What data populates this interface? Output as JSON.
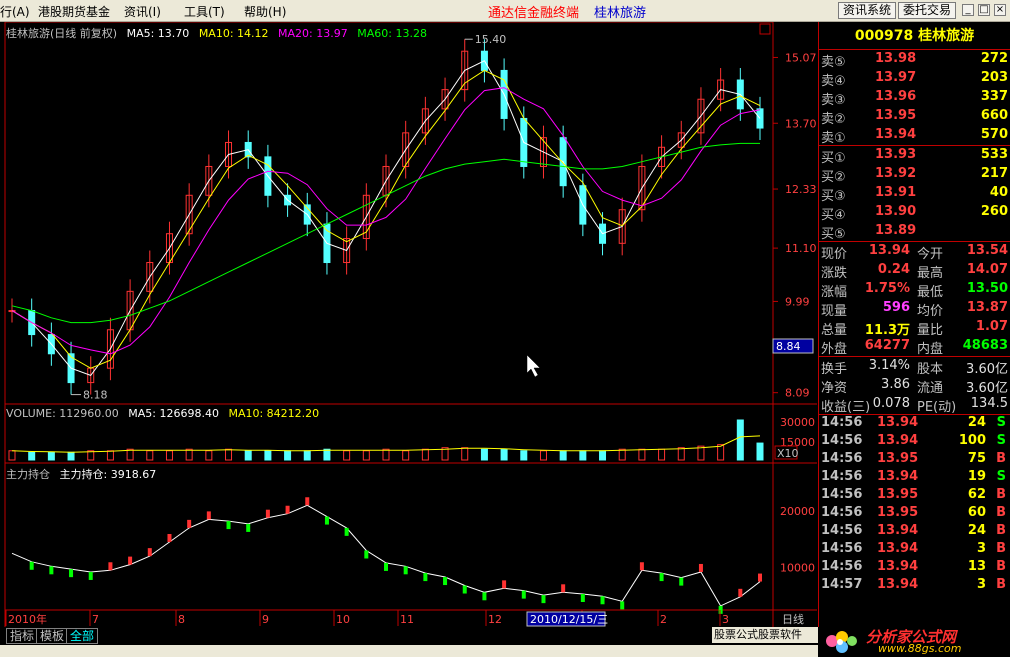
{
  "menubar": {
    "items": [
      "行(A)",
      "港股期货基金",
      "资讯(I)",
      "工具(T)",
      "帮助(H)"
    ],
    "app_title": "通达信金融终端",
    "stock_title": "桂林旅游",
    "buttons": [
      "资讯系统",
      "委托交易"
    ]
  },
  "chart_header": {
    "name": "桂林旅游(日线 前复权)",
    "ma5": "MA5: 13.70",
    "ma10": "MA10: 14.12",
    "ma20": "MA20: 13.97",
    "ma60": "MA60: 13.28"
  },
  "price_axis": {
    "labels": [
      "15.07",
      "13.70",
      "12.33",
      "11.10",
      "9.99",
      "8.09"
    ],
    "current_price_box": "8.84",
    "high_label": "15.40",
    "low_label": "8.18"
  },
  "volume_header": {
    "volume": "VOLUME: 112960.00",
    "ma5": "MA5: 126698.40",
    "ma10": "MA10: 84212.20"
  },
  "volume_axis": {
    "labels": [
      "30000",
      "15000"
    ],
    "unit": "X10"
  },
  "indicator_header": {
    "name": "主力持仓",
    "value": "主力持仓: 3918.67"
  },
  "indicator_axis": {
    "labels": [
      "20000",
      "10000"
    ]
  },
  "time_axis": {
    "labels": [
      "2010年",
      "7",
      "8",
      "9",
      "10",
      "11",
      "12",
      "1",
      "2",
      "3"
    ],
    "cursor_date": "2010/12/15/三",
    "right_label": "日线"
  },
  "colors": {
    "up": "#ff3232",
    "down": "#54ffff",
    "ma5": "#ffffff",
    "ma10": "#ffff00",
    "ma20": "#ff00ff",
    "ma60": "#00ff00",
    "border": "#c00000"
  },
  "chart_data": {
    "type": "line",
    "price_series": {
      "name": "桂林旅游",
      "values": [
        9.8,
        9.3,
        8.9,
        8.3,
        8.6,
        9.4,
        10.2,
        10.8,
        11.4,
        12.2,
        12.8,
        13.3,
        13.0,
        12.2,
        12.0,
        11.6,
        10.8,
        11.3,
        12.2,
        12.8,
        13.5,
        14.0,
        14.4,
        15.2,
        14.8,
        13.8,
        12.8,
        13.4,
        12.4,
        11.6,
        11.2,
        11.9,
        12.8,
        13.2,
        13.5,
        14.2,
        14.6,
        14.0,
        13.6
      ]
    },
    "ma60_series": {
      "name": "MA60",
      "values": [
        9.9,
        9.8,
        9.65,
        9.55,
        9.55,
        9.6,
        9.7,
        9.85,
        10.0,
        10.2,
        10.4,
        10.6,
        10.8,
        11.0,
        11.2,
        11.4,
        11.6,
        11.8,
        12.0,
        12.2,
        12.4,
        12.6,
        12.75,
        12.85,
        12.9,
        12.95,
        12.9,
        12.85,
        12.8,
        12.75,
        12.75,
        12.8,
        12.9,
        13.0,
        13.1,
        13.2,
        13.25,
        13.28,
        13.28
      ]
    },
    "ylim": [
      8.0,
      15.6
    ],
    "volume_values": [
      6,
      5,
      5,
      5,
      6,
      6,
      7,
      6,
      6,
      7,
      6,
      7,
      6,
      6,
      6,
      6,
      7,
      6,
      6,
      7,
      6,
      7,
      8,
      8,
      7,
      7,
      6,
      6,
      6,
      6,
      6,
      7,
      7,
      7,
      8,
      9,
      10,
      26,
      11
    ],
    "indicator_values": [
      12500,
      11000,
      10200,
      9700,
      9200,
      9500,
      10500,
      12000,
      14500,
      17000,
      18500,
      18200,
      17700,
      18800,
      19500,
      21000,
      19000,
      17000,
      13000,
      10800,
      10200,
      9000,
      8300,
      6800,
      5600,
      6300,
      5900,
      5100,
      5600,
      5300,
      4900,
      4000,
      9500,
      9000,
      8200,
      9200,
      3200,
      4800,
      7500
    ],
    "indicator_ylim": [
      3000,
      26000
    ]
  },
  "quote": {
    "code": "000978",
    "name": "桂林旅游",
    "asks": [
      {
        "label": "卖⑤",
        "price": "13.98",
        "vol": "272"
      },
      {
        "label": "卖④",
        "price": "13.97",
        "vol": "203"
      },
      {
        "label": "卖③",
        "price": "13.96",
        "vol": "337"
      },
      {
        "label": "卖②",
        "price": "13.95",
        "vol": "660"
      },
      {
        "label": "卖①",
        "price": "13.94",
        "vol": "570"
      }
    ],
    "bids": [
      {
        "label": "买①",
        "price": "13.93",
        "vol": "533"
      },
      {
        "label": "买②",
        "price": "13.92",
        "vol": "217"
      },
      {
        "label": "买③",
        "price": "13.91",
        "vol": "40"
      },
      {
        "label": "买④",
        "price": "13.90",
        "vol": "260"
      },
      {
        "label": "买⑤",
        "price": "13.89",
        "vol": ""
      }
    ],
    "stats": [
      {
        "l1": "现价",
        "v1": "13.94",
        "l2": "今开",
        "v2": "13.54",
        "c1": "#ff4040",
        "c2": "#ff4040"
      },
      {
        "l1": "涨跌",
        "v1": "0.24",
        "l2": "最高",
        "v2": "14.07",
        "c1": "#ff4040",
        "c2": "#ff4040"
      },
      {
        "l1": "涨幅",
        "v1": "1.75%",
        "l2": "最低",
        "v2": "13.50",
        "c1": "#ff4040",
        "c2": "#00ff00"
      },
      {
        "l1": "现量",
        "v1": "596",
        "l2": "均价",
        "v2": "13.87",
        "c1": "#ff40ff",
        "c2": "#ff4040"
      },
      {
        "l1": "总量",
        "v1": "11.3万",
        "l2": "量比",
        "v2": "1.07",
        "c1": "#ffff00",
        "c2": "#ff4040"
      },
      {
        "l1": "外盘",
        "v1": "64277",
        "l2": "内盘",
        "v2": "48683",
        "c1": "#ff4040",
        "c2": "#00ff00"
      }
    ],
    "stats2": [
      {
        "l1": "换手",
        "v1": "3.14%",
        "l2": "股本",
        "v2": "3.60亿"
      },
      {
        "l1": "净资",
        "v1": "3.86",
        "l2": "流通",
        "v2": "3.60亿"
      },
      {
        "l1": "收益(三)",
        "v1": "0.078",
        "l2": "PE(动)",
        "v2": "134.5"
      }
    ],
    "ticks": [
      {
        "time": "14:56",
        "price": "13.94",
        "vol": "24",
        "side": "S"
      },
      {
        "time": "14:56",
        "price": "13.94",
        "vol": "100",
        "side": "S"
      },
      {
        "time": "14:56",
        "price": "13.95",
        "vol": "75",
        "side": "B"
      },
      {
        "time": "14:56",
        "price": "13.94",
        "vol": "19",
        "side": "S"
      },
      {
        "time": "14:56",
        "price": "13.95",
        "vol": "62",
        "side": "B"
      },
      {
        "time": "14:56",
        "price": "13.95",
        "vol": "60",
        "side": "B"
      },
      {
        "time": "14:56",
        "price": "13.94",
        "vol": "24",
        "side": "B"
      },
      {
        "time": "14:56",
        "price": "13.94",
        "vol": "3",
        "side": "B"
      },
      {
        "time": "14:56",
        "price": "13.94",
        "vol": "13",
        "side": "B"
      },
      {
        "time": "14:57",
        "price": "13.94",
        "vol": "3",
        "side": "B"
      }
    ]
  },
  "bottom": {
    "tabs": [
      "指标",
      "模板",
      "全部"
    ],
    "ad_text": "股票公式股票软件",
    "logo_site": "分析家公式网",
    "logo_url": "www.88gs.com"
  }
}
